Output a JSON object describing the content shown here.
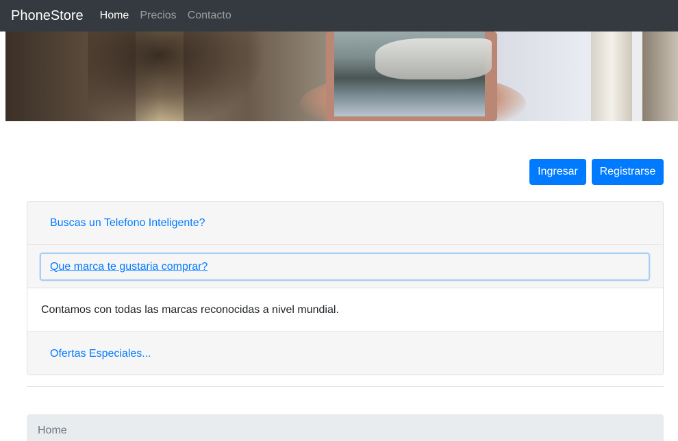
{
  "navbar": {
    "brand": "PhoneStore",
    "links": [
      {
        "label": "Home",
        "active": true
      },
      {
        "label": "Precios",
        "active": false
      },
      {
        "label": "Contacto",
        "active": false
      }
    ]
  },
  "auth": {
    "login_label": "Ingresar",
    "register_label": "Registrarse"
  },
  "accordion": {
    "items": [
      {
        "type": "header",
        "label": "Buscas un Telefono Inteligente?"
      },
      {
        "type": "header",
        "label": "Que marca te gustaria comprar?",
        "focused": true
      },
      {
        "type": "body",
        "text": "Contamos con todas las marcas reconocidas a nivel mundial."
      },
      {
        "type": "header",
        "label": "Ofertas Especiales..."
      }
    ]
  },
  "breadcrumb": {
    "current": "Home"
  },
  "colors": {
    "navbar_bg": "#343a40",
    "primary": "#007bff",
    "breadcrumb_bg": "#e9ecef"
  }
}
